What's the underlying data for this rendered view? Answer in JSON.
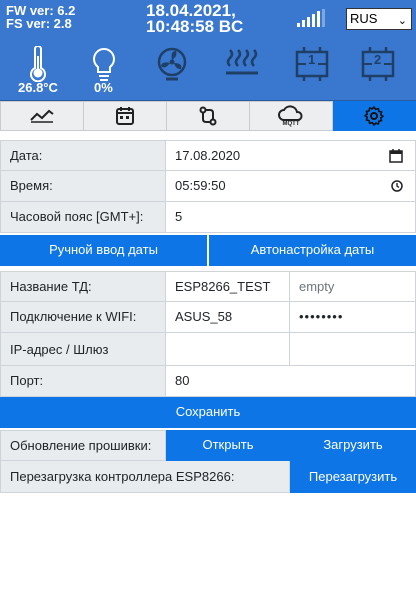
{
  "header": {
    "fw_version": "FW ver: 6.2",
    "fs_version": "FS ver: 2.8",
    "date": "18.04.2021,",
    "time": "10:48:58 BC",
    "language": "RUS",
    "temperature": "26.8°C",
    "light": "0%",
    "relay1": "1",
    "relay2": "2"
  },
  "tabs": [
    {
      "icon": "chart-icon",
      "active": false
    },
    {
      "icon": "calendar-icon",
      "active": false
    },
    {
      "icon": "git-compare-icon",
      "active": false
    },
    {
      "icon": "mqtt-cloud-icon",
      "label": "MQTT",
      "active": false
    },
    {
      "icon": "gear-icon",
      "active": true
    }
  ],
  "form": {
    "date_label": "Дата:",
    "date_value": "17.08.2020",
    "time_label": "Время:",
    "time_value": "05:59:50",
    "tz_label": "Часовой пояс [GMT+]:",
    "tz_value": "5",
    "manual_date_button": "Ручной ввод даты",
    "auto_date_button": "Автонастройка даты",
    "td_name_label": "Название ТД:",
    "td_name_value": "ESP8266_TEST",
    "td_password_placeholder": "empty",
    "wifi_label": "Подключение к WIFI:",
    "wifi_ssid": "ASUS_58",
    "wifi_password": "••••••••",
    "ip_label": "IP-адрес / Шлюз",
    "ip_value": "",
    "gateway_value": "",
    "port_label": "Порт:",
    "port_value": "80",
    "save_button": "Сохранить",
    "firmware_label": "Обновление прошивки:",
    "open_button": "Открыть",
    "upload_button": "Загрузить",
    "reboot_label": "Перезагрузка контроллера ESP8266:",
    "reboot_button": "Перезагрузить"
  }
}
